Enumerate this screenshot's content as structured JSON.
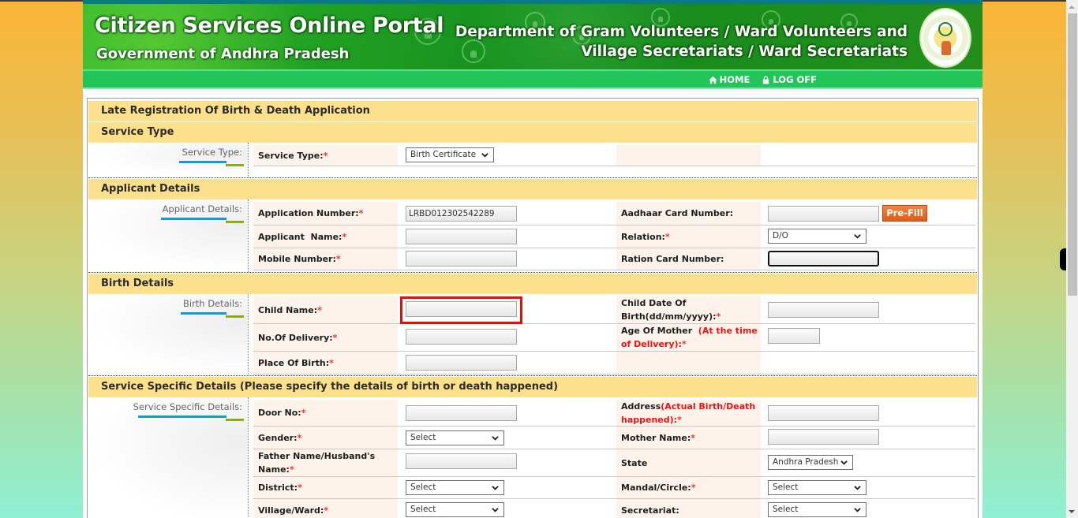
{
  "header": {
    "title": "Citizen Services Online Portal",
    "subtitle": "Government of Andhra Pradesh",
    "department_line1": "Department of Gram Volunteers / Ward Volunteers and",
    "department_line2": "Village Secretariats / Ward Secretariats",
    "emblem_icon": "ap-state-emblem"
  },
  "nav": {
    "home": {
      "label": "HOME",
      "icon": "home-icon"
    },
    "logoff": {
      "label": "LOG OFF",
      "icon": "lock-icon"
    }
  },
  "form": {
    "title": "Late Registration Of Birth & Death Application",
    "service_type": {
      "heading": "Service Type",
      "side_label": "Service Type:",
      "field_label": "Service Type:",
      "value": "Birth Certificate"
    },
    "applicant": {
      "heading": "Applicant Details",
      "side_label": "Applicant Details:",
      "application_number_label": "Application Number:",
      "application_number_value": "LRBD012302542289",
      "applicant_name_label": "Applicant  Name:",
      "applicant_name_value": "",
      "mobile_label": "Mobile Number:",
      "mobile_value": "",
      "aadhaar_label": "Aadhaar Card Number:",
      "aadhaar_value": "",
      "prefill_label": "Pre-Fill",
      "relation_label": "Relation:",
      "relation_value": "D/O",
      "ration_label": "Ration Card Number:",
      "ration_value": ""
    },
    "birth": {
      "heading": "Birth Details",
      "side_label": "Birth Details:",
      "child_name_label": "Child Name:",
      "child_name_value": "",
      "delivery_label": "No.Of Delivery:",
      "delivery_value": "",
      "place_label": "Place Of Birth:",
      "place_value": "",
      "dob_label_a": "Child Date Of",
      "dob_label_b": "Birth(dd/mm/yyyy):",
      "dob_value": "",
      "mother_age_label": "Age Of Mother",
      "mother_age_note_a": "(At the time",
      "mother_age_note_b": "of Delivery):",
      "mother_age_value": ""
    },
    "service_specific": {
      "heading": "Service Specific Details (Please specify the details of birth or death happened)",
      "side_label": "Service Specific Details:",
      "door_label": "Door No:",
      "door_value": "",
      "gender_label": "Gender:",
      "gender_value": "Select",
      "father_label_a": "Father Name/Husband's",
      "father_label_b": "Name:",
      "father_value": "",
      "district_label": "District:",
      "district_value": "Select",
      "village_label": "Village/Ward:",
      "village_value": "Select",
      "address_label": "Address",
      "address_note_a": "(Actual Birth/Death",
      "address_note_b": "happened):",
      "address_value": "",
      "mother_name_label": "Mother Name:",
      "mother_name_value": "",
      "state_label": "State",
      "state_value": "Andhra Pradesh",
      "mandal_label": "Mandal/Circle:",
      "mandal_value": "Select",
      "secretariat_label": "Secretariat:",
      "secretariat_value": "Select"
    },
    "required_marker": "*"
  },
  "colors": {
    "section_header": "#fde08b",
    "label_bg": "#fdf3ea",
    "nav_green": "#22c55a",
    "prefill_orange": "#e0651f",
    "highlight_red": "#ee0a0a"
  }
}
